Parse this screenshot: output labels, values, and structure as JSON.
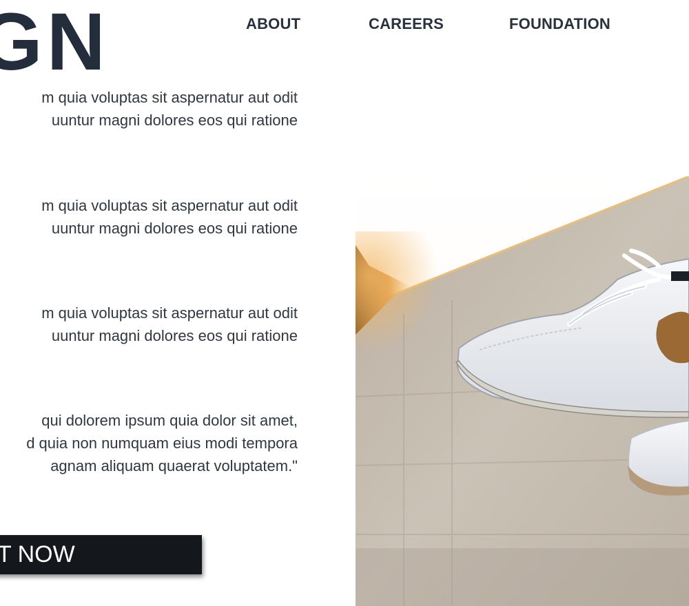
{
  "brand": {
    "text": "GN"
  },
  "nav": {
    "about": "ABOUT",
    "careers": "CAREERS",
    "foundation": "FOUNDATION"
  },
  "content": {
    "paragraphs": [
      {
        "lines": [
          "m quia voluptas sit aspernatur aut odit",
          "uuntur magni dolores eos qui ratione"
        ]
      },
      {
        "lines": [
          "m quia voluptas sit aspernatur aut odit",
          "uuntur magni dolores eos qui ratione"
        ]
      },
      {
        "lines": [
          "m quia voluptas sit aspernatur aut odit",
          "uuntur magni dolores eos qui ratione"
        ]
      },
      {
        "lines": [
          "qui dolorem ipsum quia dolor sit amet,",
          "d quia non numquam eius modi tempora",
          "agnam aliquam quaerat voluptatem.\""
        ]
      }
    ]
  },
  "cta": {
    "label": "T NOW"
  },
  "colors": {
    "heading": "#242d3c",
    "text": "#2f3742",
    "button_bg": "#14171c",
    "button_text": "#ffffff"
  },
  "hero_image": {
    "subject": "white-sneakers-over-concrete-wall"
  }
}
